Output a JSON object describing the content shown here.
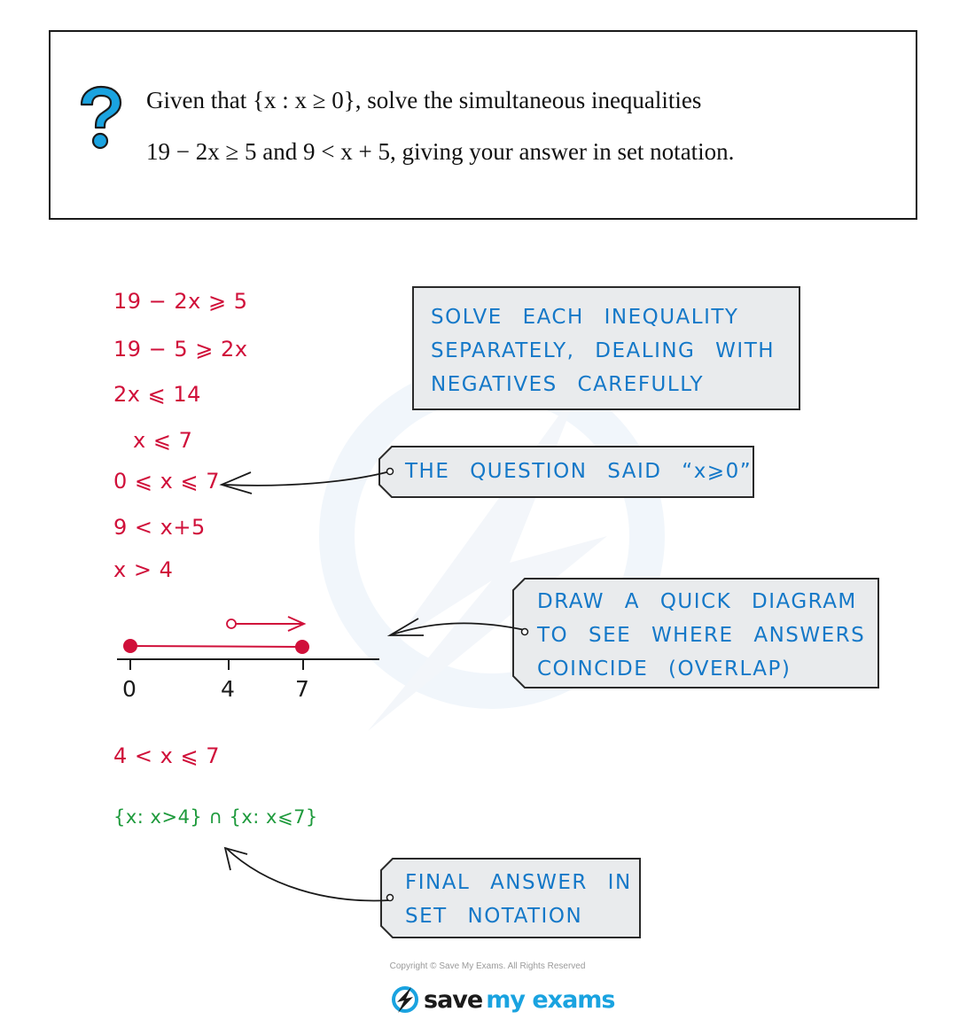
{
  "question": {
    "icon": "question-mark-icon",
    "line1_pre": "Given that ",
    "line1_set": "{x : x ≥ 0}",
    "line1_post": ", solve the simultaneous inequalities",
    "line2": "19 − 2x ≥ 5 and 9 < x + 5, giving your answer in set notation."
  },
  "working": {
    "steps": [
      "19 − 2x ⩾ 5",
      "19 − 5 ⩾ 2x",
      "2x ⩽ 14",
      "x ⩽ 7",
      "0 ⩽ x ⩽ 7",
      "9 < x+5",
      "x > 4"
    ],
    "combined": "4 < x ⩽ 7",
    "set_answer": "{x: x>4} ∩ {x: x⩽7}"
  },
  "number_line": {
    "ticks": [
      "0",
      "4",
      "7"
    ],
    "closed_interval": {
      "from": 0,
      "to": 7,
      "from_closed": true,
      "to_closed": true
    },
    "open_ray": {
      "from": 4,
      "from_closed": false,
      "direction": "right"
    }
  },
  "notes": {
    "solve": [
      "SOLVE EACH INEQUALITY",
      "SEPARATELY, DEALING WITH",
      "NEGATIVES CAREFULLY"
    ],
    "question_said": [
      "THE QUESTION SAID “x⩾0”"
    ],
    "diagram": [
      "DRAW A QUICK DIAGRAM",
      "TO SEE WHERE ANSWERS",
      "COINCIDE (OVERLAP)"
    ],
    "final": [
      "FINAL ANSWER IN",
      "SET NOTATION"
    ]
  },
  "colors": {
    "working": "#d0103a",
    "answer": "#1e9a3c",
    "note_text": "#1478c8",
    "note_bg": "#e9ebed",
    "icon": "#1aa3e0"
  },
  "footer": {
    "copyright": "Copyright © Save My Exams. All Rights Reserved",
    "brand_part1": "save",
    "brand_part2": "my exams"
  }
}
